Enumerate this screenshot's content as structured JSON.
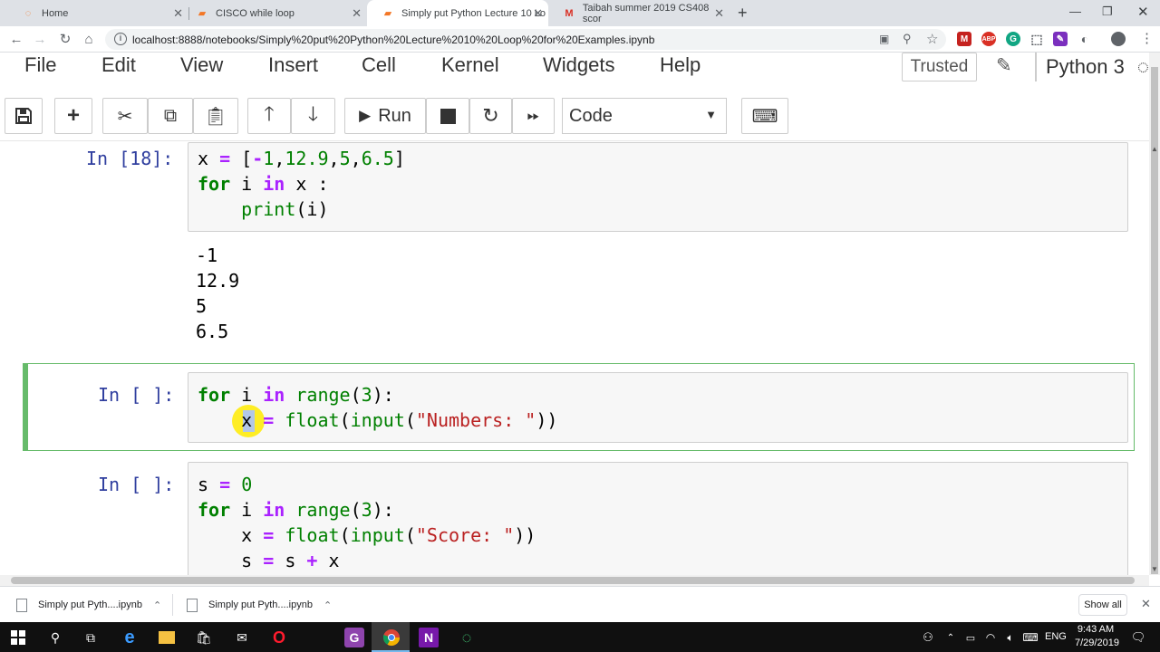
{
  "browser": {
    "tabs": [
      {
        "label": "Home",
        "icon": "jupyter-icon"
      },
      {
        "label": "CISCO while loop",
        "icon": "notebook-icon"
      },
      {
        "label": "Simply put Python Lecture 10 Lo",
        "icon": "notebook-icon"
      },
      {
        "label": "Taibah summer 2019 CS408 scor",
        "icon": "gmail-icon"
      }
    ],
    "url": "localhost:8888/notebooks/Simply%20put%20Python%20Lecture%2010%20Loop%20for%20Examples.ipynb"
  },
  "jupyter": {
    "menu": [
      "File",
      "Edit",
      "View",
      "Insert",
      "Cell",
      "Kernel",
      "Widgets",
      "Help"
    ],
    "trusted": "Trusted",
    "kernel": "Python 3",
    "toolbar": {
      "run_label": "Run",
      "cell_type": "Code"
    }
  },
  "cells": [
    {
      "prompt": "In [18]:",
      "code": [
        "x = [-1,12.9,5,6.5]",
        "for i in x :",
        "    print(i)"
      ],
      "output": [
        "-1",
        "12.9",
        "5",
        "6.5"
      ]
    },
    {
      "prompt": "In [ ]:",
      "code": [
        "for i in range(3):",
        "    x = float(input(\"Numbers: \"))"
      ]
    },
    {
      "prompt": "In [ ]:",
      "code": [
        "s = 0",
        "for i in range(3):",
        "    x = float(input(\"Score: \"))",
        "    s = s + x"
      ]
    }
  ],
  "downloads": {
    "items": [
      "Simply put Pyth....ipynb",
      "Simply put Pyth....ipynb"
    ],
    "show_all": "Show all"
  },
  "taskbar": {
    "language": "ENG",
    "time": "9:43 AM",
    "date": "7/29/2019"
  }
}
